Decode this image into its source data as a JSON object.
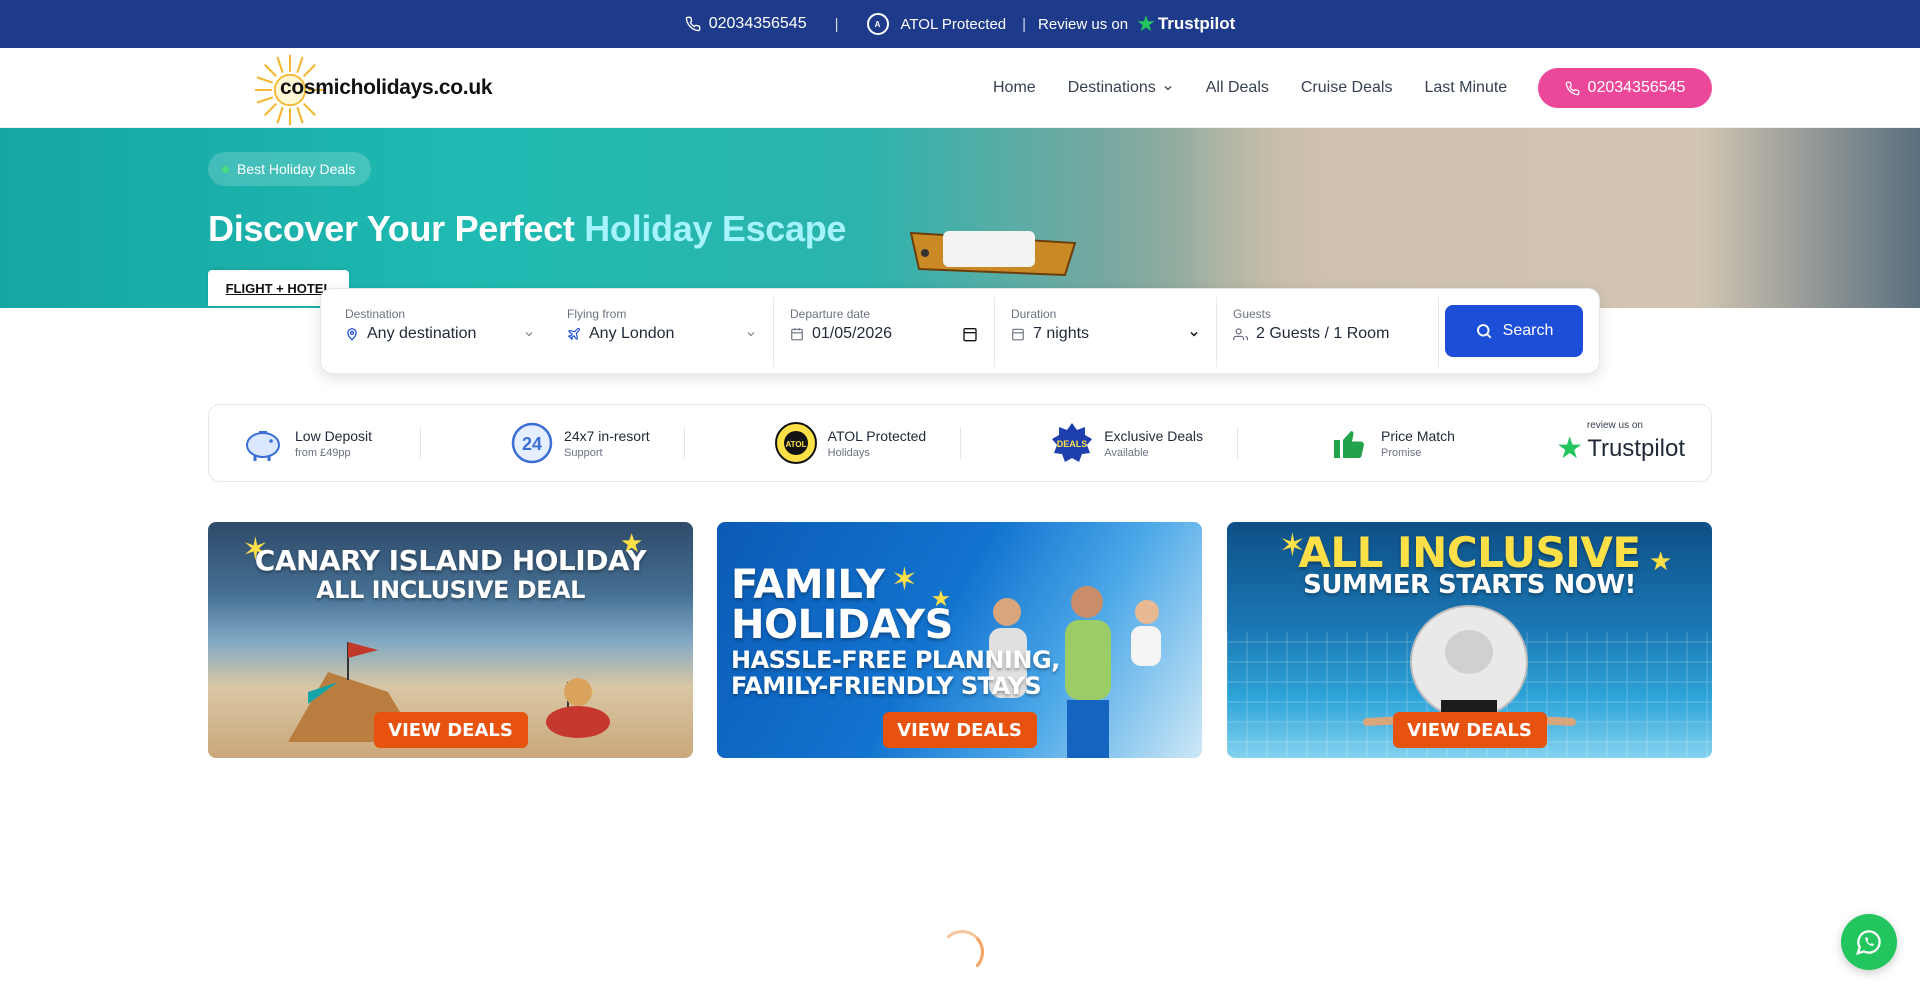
{
  "topbar": {
    "phone": "02034356545",
    "atol": "ATOL Protected",
    "review_prefix": "Review us on",
    "trustpilot": "Trustpilot"
  },
  "header": {
    "logo_text": "cosmicholidays.co.uk",
    "nav": [
      "Home",
      "Destinations",
      "All Deals",
      "Cruise Deals",
      "Last Minute"
    ],
    "call_button": "02034356545"
  },
  "hero": {
    "badge": "Best Holiday Deals",
    "title_main": "Discover Your Perfect ",
    "title_highlight": "Holiday Escape",
    "tab": "FLIGHT + HOTEL"
  },
  "search": {
    "destination": {
      "label": "Destination",
      "value": "Any destination"
    },
    "flying_from": {
      "label": "Flying from",
      "value": "Any London"
    },
    "departure": {
      "label": "Departure date",
      "value": "01/05/2026"
    },
    "duration": {
      "label": "Duration",
      "value": "7 nights"
    },
    "guests": {
      "label": "Guests",
      "value": "2 Guests / 1 Room"
    },
    "button": "Search"
  },
  "features": [
    {
      "title": "Low Deposit",
      "sub": "from £49pp",
      "icon": "piggy-bank-icon"
    },
    {
      "title": "24x7 in-resort",
      "sub": "Support",
      "icon": "24-support-icon"
    },
    {
      "title": "ATOL Protected",
      "sub": "Holidays",
      "icon": "atol-icon"
    },
    {
      "title": "Exclusive Deals",
      "sub": "Available",
      "icon": "exclusive-deals-icon"
    },
    {
      "title": "Price Match",
      "sub": "Promise",
      "icon": "thumbs-up-icon"
    }
  ],
  "trustpilot_block": {
    "small": "review us on",
    "brand": "Trustpilot"
  },
  "cards": [
    {
      "line1": "CANARY ISLAND HOLIDAY",
      "line2": "ALL INCLUSIVE DEAL",
      "button": "VIEW DEALS"
    },
    {
      "line1": "FAMILY",
      "line2": "HOLIDAYS",
      "line3": "HASSLE-FREE PLANNING,",
      "line4": "FAMILY-FRIENDLY STAYS",
      "button": "VIEW DEALS"
    },
    {
      "line1": "ALL INCLUSIVE",
      "line2": "SUMMER STARTS NOW!",
      "button": "VIEW DEALS"
    }
  ],
  "colors": {
    "topbar": "#1e3a8a",
    "accent_pink": "#ec4899",
    "search_blue": "#1d4ed8",
    "deal_orange": "#e8520f",
    "whatsapp": "#22c55e"
  }
}
